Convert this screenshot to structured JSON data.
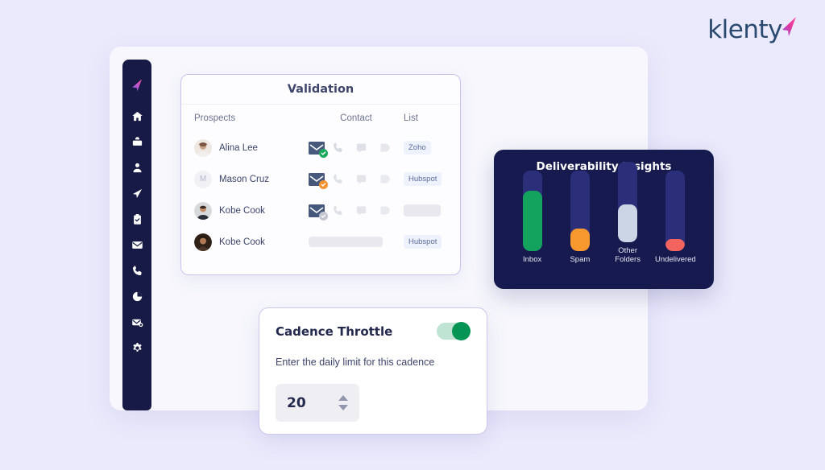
{
  "brand": {
    "name": "klenty",
    "mark": "paper-plane-mark"
  },
  "sidebar": {
    "items": [
      {
        "icon": "klenty-logo-icon",
        "label": "Klenty"
      },
      {
        "icon": "home-icon",
        "label": "Home"
      },
      {
        "icon": "inbox-download-icon",
        "label": "Inbox"
      },
      {
        "icon": "person-icon",
        "label": "Prospects"
      },
      {
        "icon": "send-icon",
        "label": "Cadences"
      },
      {
        "icon": "clipboard-check-icon",
        "label": "Tasks"
      },
      {
        "icon": "envelope-icon",
        "label": "Emails"
      },
      {
        "icon": "phone-icon",
        "label": "Calls"
      },
      {
        "icon": "pie-chart-icon",
        "label": "Reports"
      },
      {
        "icon": "email-badge-icon",
        "label": "Templates"
      },
      {
        "icon": "gear-icon",
        "label": "Settings"
      }
    ]
  },
  "validation": {
    "title": "Validation",
    "columns": {
      "prospects": "Prospects",
      "contact": "Contact",
      "list": "List"
    },
    "rows": [
      {
        "name": "Alina Lee",
        "avatar": "photo",
        "avatar_initial": "",
        "email_status": "verified",
        "badge_color": "#1aa85c",
        "contact_masked": false,
        "list": "Zoho",
        "list_masked": false
      },
      {
        "name": "Mason Cruz",
        "avatar": "initial",
        "avatar_initial": "M",
        "email_status": "risky",
        "badge_color": "#f59331",
        "contact_masked": false,
        "list": "Hubspot",
        "list_masked": false
      },
      {
        "name": "Kobe Cook",
        "avatar": "photo",
        "avatar_initial": "",
        "email_status": "unknown",
        "badge_color": "#c3c6d1",
        "contact_masked": false,
        "list": "",
        "list_masked": true
      },
      {
        "name": "Kobe Cook",
        "avatar": "photo",
        "avatar_initial": "",
        "email_status": "none",
        "badge_color": "",
        "contact_masked": true,
        "list": "Hubspot",
        "list_masked": false
      }
    ]
  },
  "chart_data": {
    "type": "bar",
    "title": "Deliverability Insights",
    "categories": [
      "Inbox",
      "Spam",
      "Other Folders",
      "Undelivered"
    ],
    "values": [
      75,
      28,
      47,
      15
    ],
    "bar_colors": [
      "#14a35f",
      "#f7992f",
      "#ccd5e6",
      "#f4645f"
    ],
    "track_color": "#2b2f7a",
    "background": "#171a4e",
    "xlabel": "",
    "ylabel": "",
    "ylim": [
      0,
      100
    ],
    "grid": false,
    "legend": false
  },
  "cadence": {
    "title": "Cadence Throttle",
    "toggle_state": "on",
    "toggle_color": "#049454",
    "subtitle": "Enter the daily limit for this cadence",
    "limit_value": "20"
  }
}
